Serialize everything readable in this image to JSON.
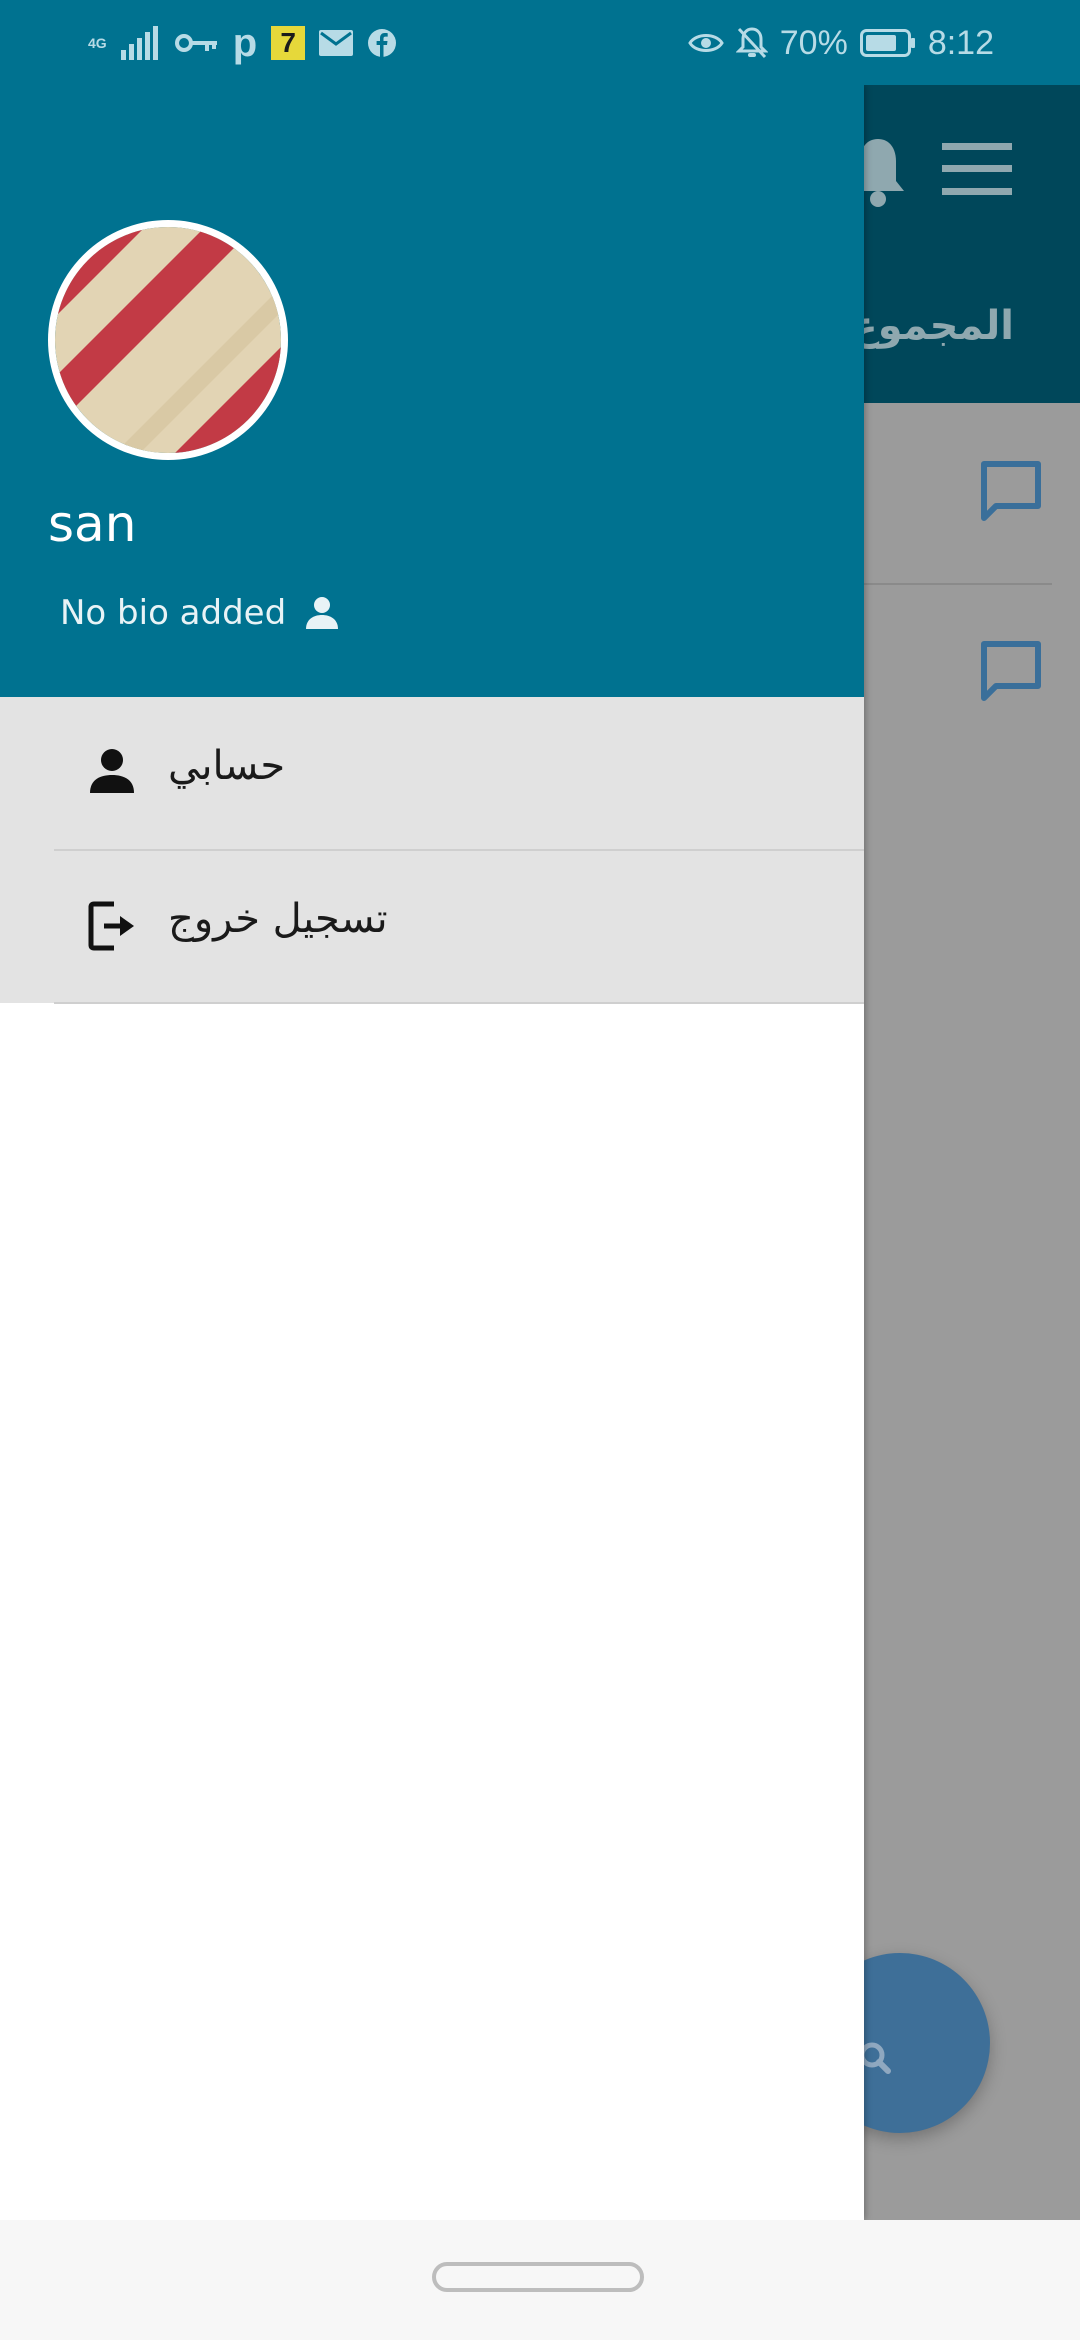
{
  "status_bar": {
    "network_type_top": "4G",
    "network_type_bottom": "4G",
    "p_icon": "p",
    "seven_badge": "7",
    "battery_percent": "70%",
    "time": "8:12"
  },
  "main_screen": {
    "title": "المجموع",
    "icons": [
      "menu-icon",
      "bell-icon",
      "chat-bubble-icon",
      "person-search-icon"
    ]
  },
  "drawer": {
    "user_name": "san",
    "bio": "No bio added",
    "menu": [
      {
        "label": "حسابي",
        "icon": "person-icon"
      },
      {
        "label": "تسجيل خروج",
        "icon": "logout-icon"
      }
    ]
  },
  "colors": {
    "primary": "#007290",
    "appbar_dark": "#00475a",
    "fab": "#3e6f98"
  }
}
